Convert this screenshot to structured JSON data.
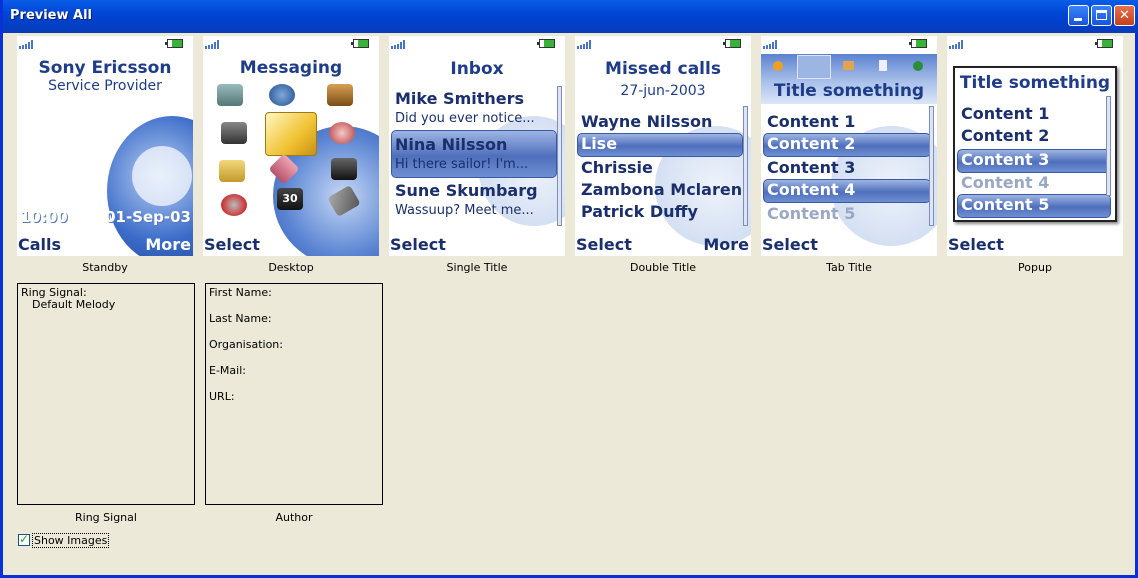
{
  "window": {
    "title": "Preview All"
  },
  "standby": {
    "title": "Sony Ericsson",
    "subtitle": "Service Provider",
    "time": "10:00",
    "date": "01-Sep-03",
    "left_soft": "Calls",
    "right_soft": "More",
    "caption": "Standby"
  },
  "desktop": {
    "title": "Messaging",
    "left_soft": "Select",
    "caption": "Desktop"
  },
  "single": {
    "title": "Inbox",
    "items": [
      {
        "name": "Mike Smithers",
        "preview": "Did you ever notice..."
      },
      {
        "name": "Nina Nilsson",
        "preview": "Hi there sailor!  I'm..."
      },
      {
        "name": "Sune Skumbarg",
        "preview": "Wassuup?  Meet me..."
      }
    ],
    "left_soft": "Select",
    "caption": "Single Title"
  },
  "double": {
    "title": "Missed calls",
    "subtitle": "27-jun-2003",
    "items": [
      "Wayne Nilsson",
      "Lise",
      "Chrissie",
      "Zambona Mclaren",
      "Patrick Duffy"
    ],
    "left_soft": "Select",
    "right_soft": "More",
    "caption": "Double Title"
  },
  "tab": {
    "title": "Title something",
    "items": [
      "Content 1",
      "Content 2",
      "Content 3",
      "Content 4",
      "Content 5"
    ],
    "left_soft": "Select",
    "caption": "Tab Title"
  },
  "popup": {
    "title": "Title something",
    "items": [
      "Content 1",
      "Content 2",
      "Content 3",
      "Content 4",
      "Content 5"
    ],
    "left_soft": "Select",
    "caption": "Popup"
  },
  "ring": {
    "label": "Ring Signal:",
    "value": "Default Melody",
    "caption": "Ring Signal"
  },
  "author": {
    "fields": [
      "First Name:",
      "Last Name:",
      "Organisation:",
      "E-Mail:",
      "URL:"
    ],
    "caption": "Author"
  },
  "show_images": {
    "label": "Show Images",
    "checked": true
  },
  "colors": {
    "title_text": "#1e3c88",
    "highlight": "#4f6fbc",
    "titlebar": "#0046d5"
  }
}
